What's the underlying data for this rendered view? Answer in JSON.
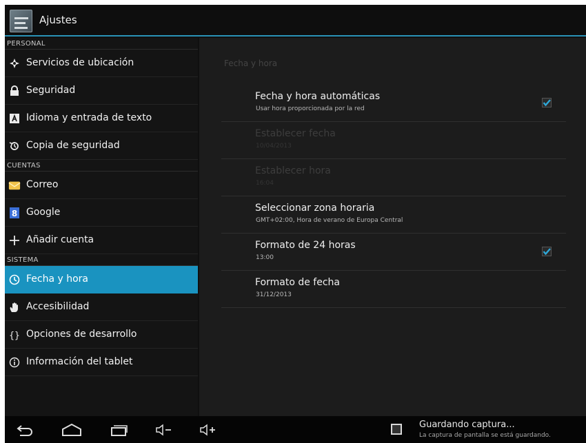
{
  "app": {
    "title": "Ajustes"
  },
  "sidebar": {
    "sections": [
      {
        "header": "PERSONAL",
        "items": [
          {
            "label": "Servicios de ubicación",
            "icon": "location-icon"
          },
          {
            "label": "Seguridad",
            "icon": "lock-icon"
          },
          {
            "label": "Idioma y entrada de texto",
            "icon": "language-icon"
          },
          {
            "label": "Copia de seguridad",
            "icon": "backup-icon"
          }
        ]
      },
      {
        "header": "CUENTAS",
        "items": [
          {
            "label": "Correo",
            "icon": "mail-icon"
          },
          {
            "label": "Google",
            "icon": "google-icon"
          },
          {
            "label": "Añadir cuenta",
            "icon": "plus-icon"
          }
        ]
      },
      {
        "header": "SISTEMA",
        "items": [
          {
            "label": "Fecha y hora",
            "icon": "clock-icon",
            "selected": true
          },
          {
            "label": "Accesibilidad",
            "icon": "hand-icon"
          },
          {
            "label": "Opciones de desarrollo",
            "icon": "braces-icon"
          },
          {
            "label": "Información del tablet",
            "icon": "info-icon"
          }
        ]
      }
    ]
  },
  "main": {
    "heading": "Fecha y hora",
    "prefs": [
      {
        "title": "Fecha y hora automáticas",
        "summary": "Usar hora proporcionada por la red",
        "checked": true,
        "enabled": true
      },
      {
        "title": "Establecer fecha",
        "summary": "10/04/2013",
        "enabled": false
      },
      {
        "title": "Establecer hora",
        "summary": "16:04",
        "enabled": false
      },
      {
        "title": "Seleccionar zona horaria",
        "summary": "GMT+02:00, Hora de verano de Europa Central",
        "enabled": true
      },
      {
        "title": "Formato de 24 horas",
        "summary": "13:00",
        "checked": true,
        "enabled": true
      },
      {
        "title": "Formato de fecha",
        "summary": "31/12/2013",
        "enabled": true
      }
    ]
  },
  "navbar": {
    "buttons": [
      "back-icon",
      "home-icon",
      "recents-icon",
      "volume-down-icon",
      "volume-up-icon"
    ],
    "notification": {
      "title": "Guardando captura...",
      "subtitle": "La captura de pantalla se está guardando."
    }
  },
  "colors": {
    "accent": "#1a93c0",
    "check": "#2fa8d8"
  }
}
